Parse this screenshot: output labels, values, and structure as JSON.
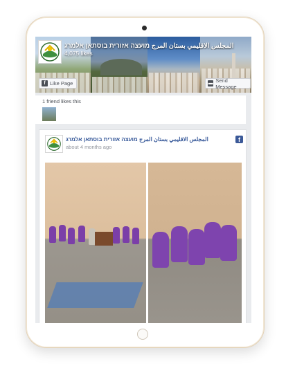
{
  "page": {
    "name": "المجلس الاقليمي بستان المرج מועצה אזורית בוסתאן אלמרג",
    "likes": "4,075 likes",
    "like_page_label": "Like Page",
    "send_message_label": "Send Message"
  },
  "friends": {
    "text": "1 friend likes this"
  },
  "post": {
    "author": "المجلس الاقليمي بستان المرج מועצה אזורית בוסתאן אלמרג",
    "time": "about 4 months ago"
  },
  "colors": {
    "facebook_blue": "#3b5998",
    "link_blue": "#365899",
    "shirt_purple": "#7b3fa8"
  },
  "icons": [
    "page-logo-icon",
    "facebook-like-icon",
    "message-icon",
    "facebook-logo-icon",
    "camera-icon",
    "home-button"
  ]
}
